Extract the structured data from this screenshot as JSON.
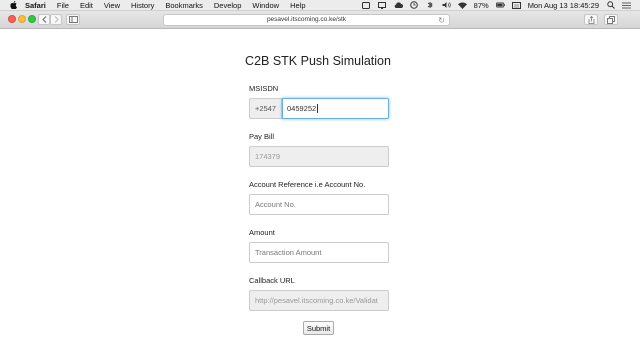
{
  "menubar": {
    "app": "Safari",
    "items": [
      "File",
      "Edit",
      "View",
      "History",
      "Bookmarks",
      "Develop",
      "Window",
      "Help"
    ],
    "battery": "87%",
    "clock": "Mon Aug 13  18:45:29"
  },
  "browser": {
    "url": "pesavel.itscoming.co.ke/stk"
  },
  "form": {
    "title": "C2B STK Push Simulation",
    "msisdn": {
      "label": "MSISDN",
      "prefix": "+2547",
      "value": "0459252"
    },
    "paybill": {
      "label": "Pay Bill",
      "value": "174379"
    },
    "account": {
      "label": "Account Reference i.e Account No.",
      "placeholder": "Account No."
    },
    "amount": {
      "label": "Amount",
      "placeholder": "Transaction Amount"
    },
    "callback": {
      "label": "Callback URL",
      "value": "http://pesavel.itscoming.co.ke/Validat"
    },
    "submit_label": "Submit"
  }
}
